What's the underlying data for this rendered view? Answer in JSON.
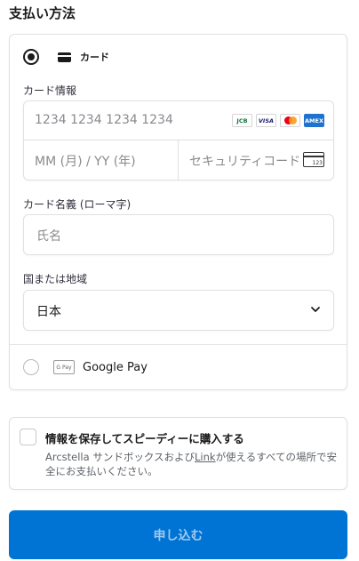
{
  "header": {
    "title": "支払い方法"
  },
  "payment_methods": {
    "card": {
      "label": "カード",
      "card_info_label": "カード情報",
      "number_placeholder": "1234 1234 1234 1234",
      "brands": [
        "JCB",
        "VISA",
        "Mastercard",
        "AMEX"
      ],
      "expiry_placeholder": "MM (月) / YY (年)",
      "cvc_placeholder": "セキュリティコード",
      "cvc_icon_text": "123",
      "name_label": "カード名義 (ローマ字)",
      "name_placeholder": "氏名",
      "country_label": "国または地域",
      "country_value": "日本"
    },
    "google_pay": {
      "label": "Google Pay",
      "badge_text": "G Pay"
    }
  },
  "save_info": {
    "title": "情報を保存してスピーディーに購入する",
    "desc_prefix": "Arcstella サンドボックスおよび",
    "desc_link": "Link",
    "desc_suffix": "が使えるすべての場所で安全にお支払いください。"
  },
  "submit": {
    "label": "申し込む"
  },
  "colors": {
    "accent": "#0074d4",
    "border": "#e0e0e0",
    "placeholder": "#8a8a8f"
  },
  "icons": {
    "card": "credit-card-icon",
    "cvc": "cvc-card-icon",
    "chevron": "chevron-down-icon",
    "gpay": "google-pay-icon"
  }
}
